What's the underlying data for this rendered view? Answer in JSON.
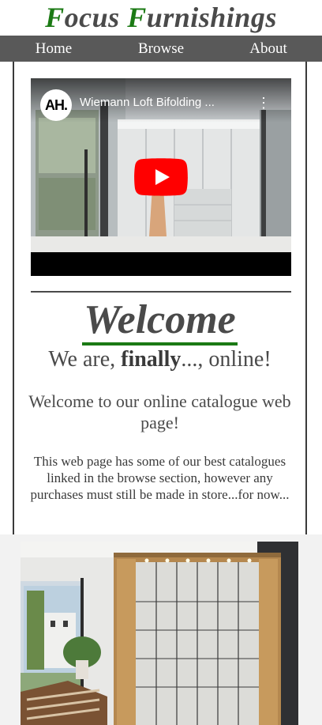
{
  "header": {
    "brand_first_initial": "F",
    "brand_first_rest": "ocus ",
    "brand_second_initial": "F",
    "brand_second_rest": "urnishings"
  },
  "nav": {
    "items": [
      {
        "label": "Home"
      },
      {
        "label": "Browse"
      },
      {
        "label": "About"
      }
    ]
  },
  "video": {
    "channel_badge": "AH.",
    "title": "Wiemann Loft Bifolding ...",
    "menu_glyph": "⋮"
  },
  "welcome": {
    "heading": "Welcome",
    "online_prefix": "We are, ",
    "online_bold": "finally",
    "online_suffix": "..., online!",
    "intro": "Welcome to our online catalogue web page!",
    "body": "This web page has some of our best catalogues linked in the browse section, however any purchases must still be made in store...for now..."
  },
  "colors": {
    "brand_green": "#1b7a14",
    "text_gray": "#4a4a4a",
    "nav_bg": "#595959",
    "youtube_red": "#ff0000"
  }
}
